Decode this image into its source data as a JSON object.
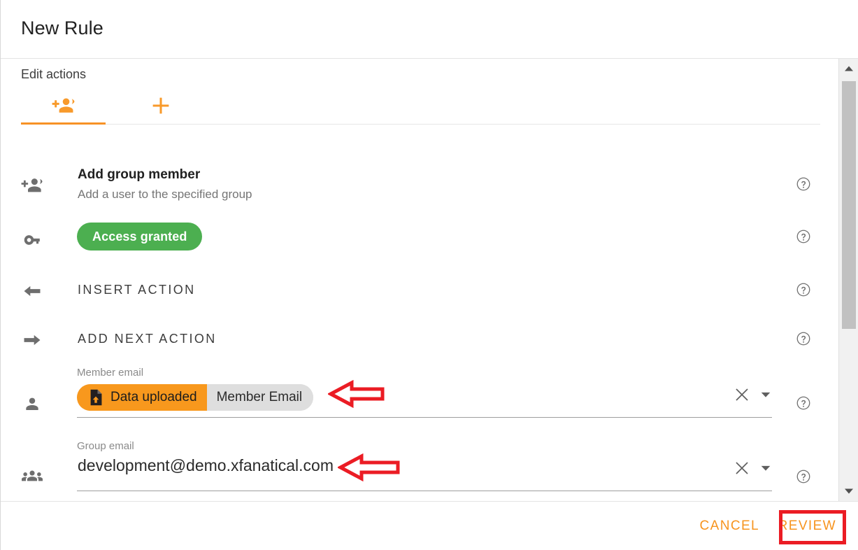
{
  "dialog": {
    "title": "New Rule",
    "section_label": "Edit actions"
  },
  "tabs": [
    {
      "id": "action-add-group-member",
      "icon": "person-add-icon",
      "label": "",
      "active": true
    },
    {
      "id": "add-action",
      "icon": "plus-icon",
      "label": "",
      "active": false
    }
  ],
  "rows": {
    "action": {
      "icon": "person-add-icon",
      "title": "Add group member",
      "subtitle": "Add a user to the specified group",
      "help": "help-icon"
    },
    "status": {
      "icon": "key-icon",
      "badge_label": "Access granted",
      "badge_color": "#4CAF50",
      "help": "help-icon"
    },
    "insert": {
      "icon": "arrow-left-icon",
      "label": "INSERT ACTION",
      "help": "help-icon"
    },
    "next": {
      "icon": "arrow-right-icon",
      "label": "ADD NEXT ACTION",
      "help": "help-icon"
    },
    "member_email": {
      "icon": "person-icon",
      "label": "Member email",
      "token_source": "Data uploaded",
      "token_field": "Member Email",
      "token_icon": "file-upload-icon",
      "clear_icon": "close-icon",
      "dropdown_icon": "chevron-down-icon",
      "help": "help-icon"
    },
    "group_email": {
      "icon": "group-icon",
      "label": "Group email",
      "value": "development@demo.xfanatical.com",
      "clear_icon": "close-icon",
      "dropdown_icon": "chevron-down-icon",
      "help": "help-icon"
    }
  },
  "scrollbar": {
    "up_icon": "scroll-up-icon",
    "down_icon": "scroll-down-icon"
  },
  "footer": {
    "cancel_label": "CANCEL",
    "review_label": "REVIEW"
  },
  "theme": {
    "accent": "#F7941E",
    "success": "#4CAF50",
    "annotation": "#EB1C24"
  }
}
